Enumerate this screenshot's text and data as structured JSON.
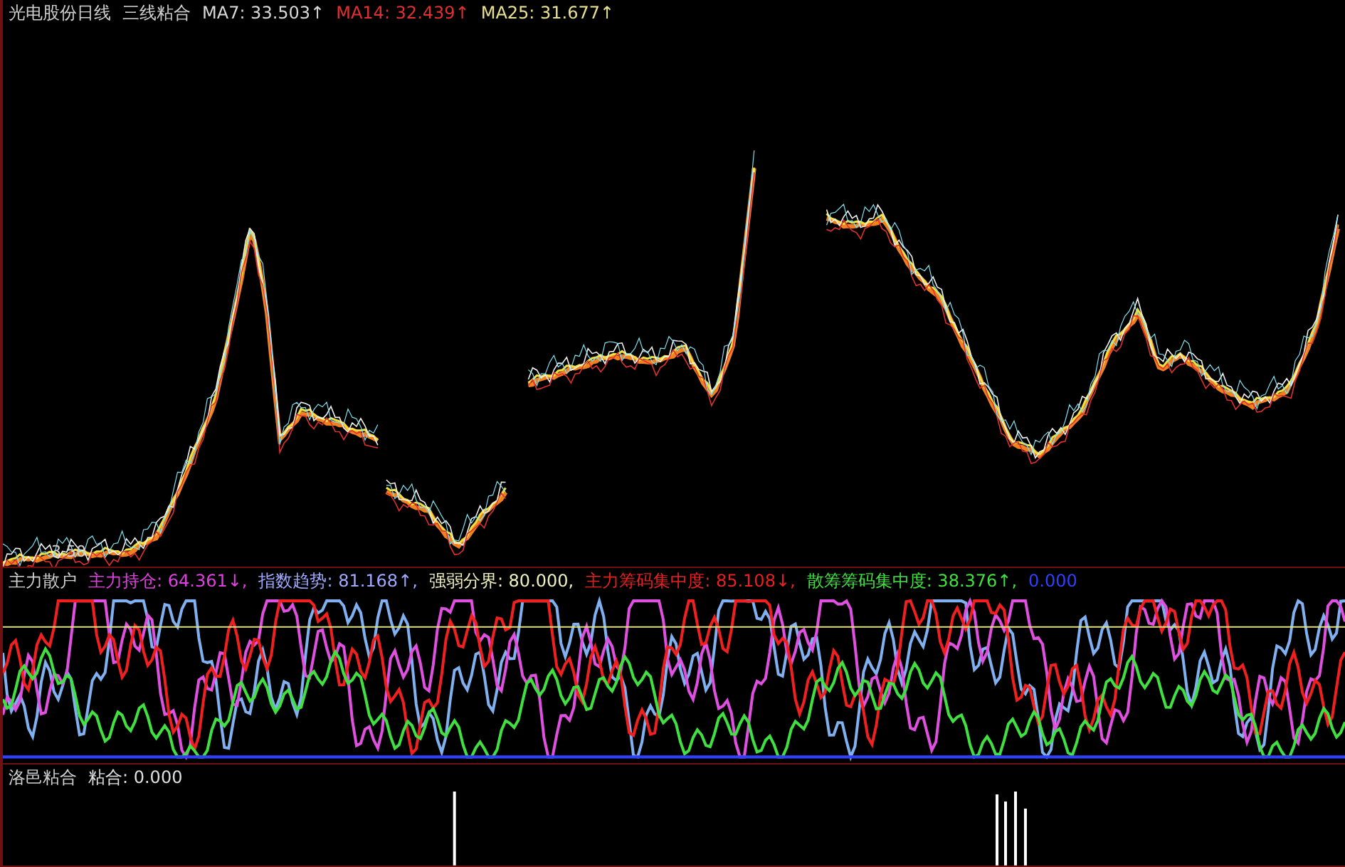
{
  "main_panel": {
    "title": "光电股份日线",
    "indicator_name": "三线粘合",
    "legend": [
      {
        "text": "MA7: 33.503↑",
        "color": "#d8d8d8"
      },
      {
        "text": "MA14: 32.439↑",
        "color": "#e03030"
      },
      {
        "text": "MA25: 31.677↑",
        "color": "#e8e090"
      }
    ],
    "low_label": "3.50"
  },
  "indicator_panel": {
    "title": "主力散户",
    "legend": [
      {
        "text": "主力持仓: 64.361↓,",
        "color": "#e040e0"
      },
      {
        "text": "指数趋势: 81.168↑,",
        "color": "#a0a8ff"
      },
      {
        "text": "强弱分界: 80.000,",
        "color": "#f0f0c0"
      },
      {
        "text": "主力筹码集中度: 85.108↓,",
        "color": "#e82020"
      },
      {
        "text": "散筹筹码集中度: 38.376↑,",
        "color": "#40e040"
      },
      {
        "text": "0.000",
        "color": "#3040ff"
      }
    ]
  },
  "bottom_panel": {
    "title": "洛邑粘合",
    "legend": [
      {
        "text": "粘合: 0.000",
        "color": "#e0e0e0"
      }
    ]
  }
}
